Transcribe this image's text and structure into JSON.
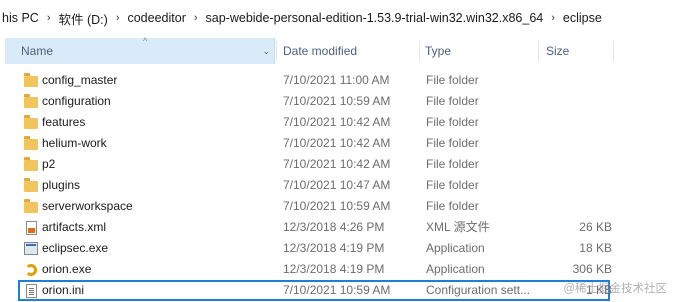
{
  "breadcrumb": [
    "his PC",
    "软件 (D:)",
    "codeeditor",
    "sap-webide-personal-edition-1.53.9-trial-win32.win32.x86_64",
    "eclipse"
  ],
  "breadcrumb_separator": "›",
  "columns": {
    "name": "Name",
    "date": "Date modified",
    "type": "Type",
    "size": "Size",
    "sort_indicator": "^",
    "name_dropdown": "⌄"
  },
  "files": [
    {
      "name": "config_master",
      "date": "7/10/2021 11:00 AM",
      "type": "File folder",
      "size": "",
      "icon": "folder-icon"
    },
    {
      "name": "configuration",
      "date": "7/10/2021 10:59 AM",
      "type": "File folder",
      "size": "",
      "icon": "folder-icon"
    },
    {
      "name": "features",
      "date": "7/10/2021 10:42 AM",
      "type": "File folder",
      "size": "",
      "icon": "folder-icon"
    },
    {
      "name": "helium-work",
      "date": "7/10/2021 10:42 AM",
      "type": "File folder",
      "size": "",
      "icon": "folder-icon"
    },
    {
      "name": "p2",
      "date": "7/10/2021 10:42 AM",
      "type": "File folder",
      "size": "",
      "icon": "folder-icon"
    },
    {
      "name": "plugins",
      "date": "7/10/2021 10:47 AM",
      "type": "File folder",
      "size": "",
      "icon": "folder-icon"
    },
    {
      "name": "serverworkspace",
      "date": "7/10/2021 10:59 AM",
      "type": "File folder",
      "size": "",
      "icon": "folder-icon"
    },
    {
      "name": "artifacts.xml",
      "date": "12/3/2018 4:26 PM",
      "type": "XML 源文件",
      "size": "26 KB",
      "icon": "xml-file-icon"
    },
    {
      "name": "eclipsec.exe",
      "date": "12/3/2018 4:19 PM",
      "type": "Application",
      "size": "18 KB",
      "icon": "exe-icon"
    },
    {
      "name": "orion.exe",
      "date": "12/3/2018 4:19 PM",
      "type": "Application",
      "size": "306 KB",
      "icon": "orion-exe-icon"
    },
    {
      "name": "orion.ini",
      "date": "7/10/2021 10:59 AM",
      "type": "Configuration sett...",
      "size": "1 KB",
      "icon": "ini-file-icon"
    }
  ],
  "watermark": "@稀土掘金技术社区",
  "colors": {
    "header_selected": "#d9ebf9",
    "highlight_border": "#1e7fd6",
    "folder": "#f2c55c"
  }
}
